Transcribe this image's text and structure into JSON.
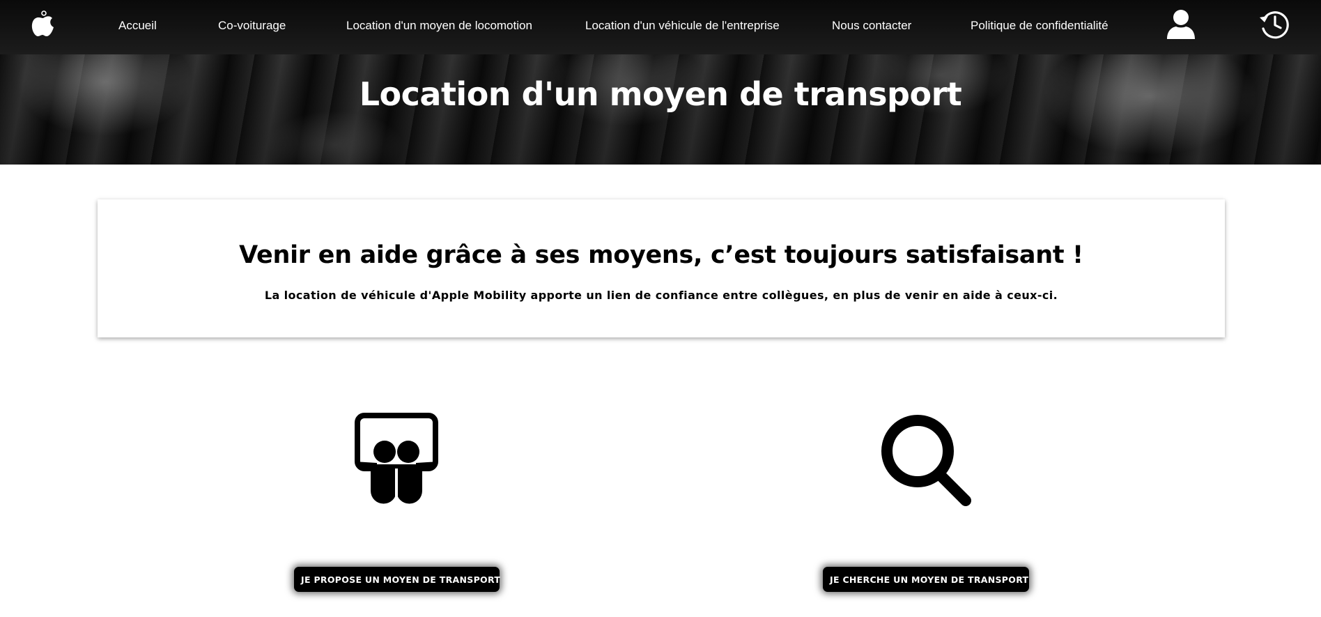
{
  "nav": {
    "logo_icon": "apple-logo-icon",
    "links": [
      {
        "label": "Accueil"
      },
      {
        "label": "Co-voiturage"
      },
      {
        "label": "Location d'un moyen de locomotion"
      },
      {
        "label": "Location d'un véhicule de l'entreprise"
      },
      {
        "label": "Nous contacter"
      },
      {
        "label": "Politique de confidentialité"
      }
    ],
    "account_icon": "user-icon",
    "history_icon": "history-icon"
  },
  "hero": {
    "title": "Location d'un moyen de transport"
  },
  "intro": {
    "title": "Venir en aide grâce à ses moyens, c’est toujours satisfaisant !",
    "text": "La location de véhicule d'Apple Mobility apporte un lien de confiance entre collègues, en plus de venir en aide à ceux-ci."
  },
  "actions": [
    {
      "icon": "slideshare-icon",
      "label": "JE PROPOSE UN MOYEN DE TRANSPORT"
    },
    {
      "icon": "search-icon",
      "label": "JE CHERCHE UN MOYEN DE TRANSPORT"
    }
  ],
  "colors": {
    "nav_background": "#111111",
    "text_on_dark": "#ffffff",
    "button_background": "#000000"
  }
}
